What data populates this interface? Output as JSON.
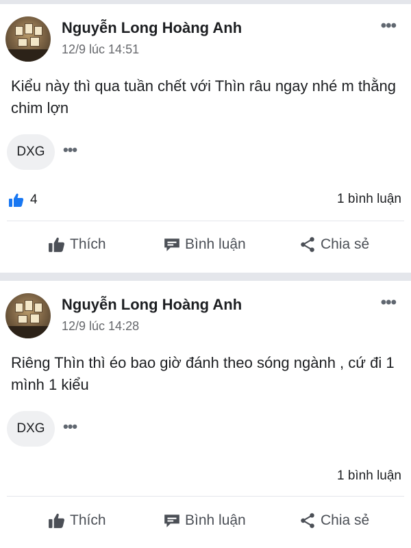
{
  "posts": [
    {
      "author": "Nguyễn Long Hoàng Anh",
      "time": "12/9 lúc 14:51",
      "text": "Kiểu này thì qua tuần chết với Thìn râu ngay nhé m thằng chim lợn",
      "tag": "DXG",
      "likes": "4",
      "comments": "1 bình luận"
    },
    {
      "author": "Nguyễn Long Hoàng Anh",
      "time": "12/9 lúc 14:28",
      "text": "Riêng Thìn thì éo bao giờ đánh theo sóng ngành , cứ đi 1 mình 1 kiểu",
      "tag": "DXG",
      "comments": "1 bình luận"
    }
  ],
  "actions": {
    "like": "Thích",
    "comment": "Bình luận",
    "share": "Chia sẻ"
  },
  "more_glyph": "•••",
  "colors": {
    "like_blue": "#1877f2",
    "icon_gray": "#4b4f56",
    "separator": "#e4e6eb"
  }
}
